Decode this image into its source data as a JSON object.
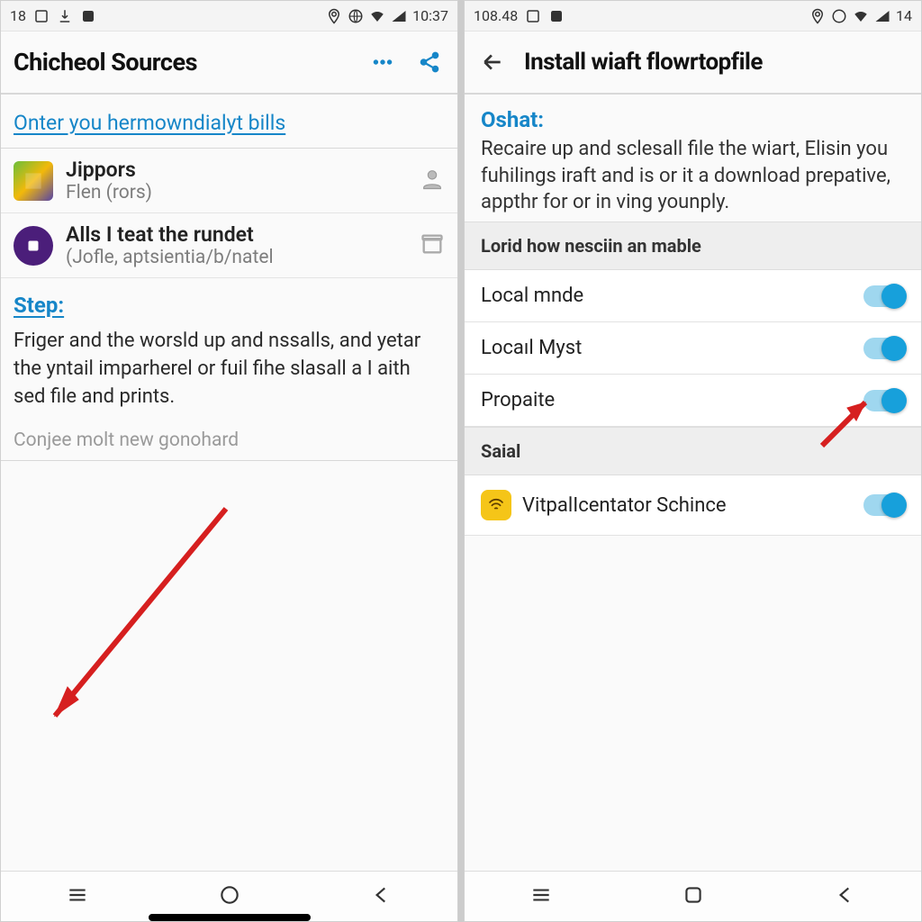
{
  "left": {
    "status": {
      "left_text": "18",
      "time": "10:37"
    },
    "appbar": {
      "title": "Chicheol Sources"
    },
    "link_text": "Onter you hermowndialyt bills",
    "items": [
      {
        "title": "Jippors",
        "subtitle": "Flen (rors)"
      },
      {
        "title": "Alls I teat the rundet",
        "subtitle": "(Jofle, aptsientia/b/natel"
      }
    ],
    "step_label": "Step:",
    "step_body": "Friger and the worsld up and nssalls, and yetar the yntail imparherel or fuil fihe slasall a I aith sed file and prints.",
    "muted": "Conjee molt new gonohard"
  },
  "right": {
    "status": {
      "left_text": "108.48",
      "time": "14"
    },
    "appbar": {
      "title": "Install wiaft flowrtopfile"
    },
    "oshat": {
      "heading": "Oshat:",
      "body": "Recaire up and sclesall file the wiart, Elisin you fuhilings iraft and is or it a download prepative, appthr for or in ving younply."
    },
    "section1": "Lorid how nesciin an mable",
    "toggles": [
      {
        "label": "Local mnde",
        "on": true
      },
      {
        "label": "Locaıl Myst",
        "on": true
      },
      {
        "label": "Propaite",
        "on": true
      }
    ],
    "section2": "Saial",
    "app_toggle": {
      "label": "VitpalIcentator Schince",
      "on": true
    }
  }
}
